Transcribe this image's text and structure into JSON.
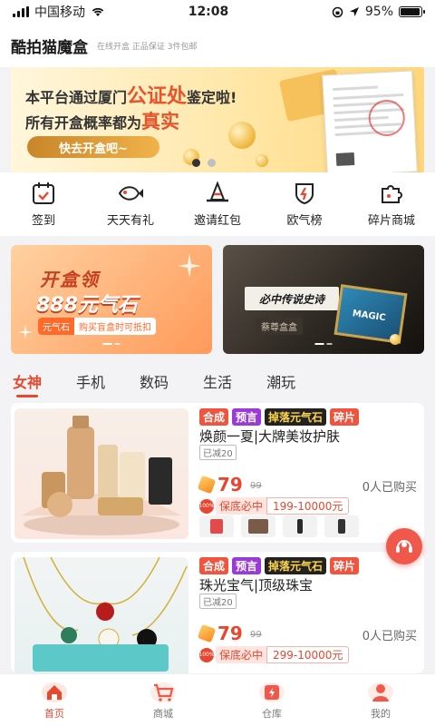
{
  "status_bar": {
    "carrier": "中国移动",
    "time": "12:08",
    "battery": "95%",
    "icons": [
      "signal-icon",
      "wifi-icon",
      "lock-rotation-icon",
      "location-icon",
      "battery-icon"
    ]
  },
  "header": {
    "title": "酷拍猫魔盒",
    "subtitle": "在线开盒 正品保证 3件包邮"
  },
  "banner": {
    "line1_prefix": "本平台通过厦门",
    "line1_highlight": "公证处",
    "line1_suffix": "鉴定啦!",
    "line2_prefix": "所有开盒概率都为",
    "line2_highlight": "真实",
    "button": "快去开盒吧~",
    "page_count": 2,
    "active_page": 1
  },
  "quick_nav": [
    {
      "label": "签到",
      "icon": "calendar-icon"
    },
    {
      "label": "天天有礼",
      "icon": "fish-gift-icon"
    },
    {
      "label": "邀请红包",
      "icon": "witch-hat-icon"
    },
    {
      "label": "欧气榜",
      "icon": "shield-rank-icon"
    },
    {
      "label": "碎片商城",
      "icon": "puzzle-icon"
    }
  ],
  "promo_left": {
    "title": "开盒领",
    "big": "888元气石",
    "tag_label": "元气石",
    "tag_text": "购买盲盒时可抵扣"
  },
  "promo_right": {
    "title": "必中传说史诗",
    "subtitle": "蔡尊盒盒",
    "crate_text": "MAGIC"
  },
  "categories": [
    {
      "label": "女神",
      "active": true
    },
    {
      "label": "手机",
      "active": false
    },
    {
      "label": "数码",
      "active": false
    },
    {
      "label": "生活",
      "active": false
    },
    {
      "label": "潮玩",
      "active": false
    }
  ],
  "products": [
    {
      "tags": [
        "合成",
        "预言",
        "掉落元气石",
        "碎片"
      ],
      "name": "焕颜一夏|大牌美妆护肤",
      "discount": "已减20",
      "price": "79",
      "old_price": "99",
      "sold": "0人已购买",
      "guarantee_badge": "100%",
      "guarantee_label": "保底必中",
      "guarantee_range": "199-10000元"
    },
    {
      "tags": [
        "合成",
        "预言",
        "掉落元气石",
        "碎片"
      ],
      "name": "珠光宝气|顶级珠宝",
      "discount": "已减20",
      "price": "79",
      "old_price": "99",
      "sold": "0人已购买",
      "guarantee_badge": "100%",
      "guarantee_label": "保底必中",
      "guarantee_range": "299-10000元"
    }
  ],
  "tabbar": [
    {
      "label": "首页",
      "icon": "home-icon",
      "active": true
    },
    {
      "label": "商城",
      "icon": "cart-icon",
      "active": false
    },
    {
      "label": "仓库",
      "icon": "warehouse-icon",
      "active": false
    },
    {
      "label": "我的",
      "icon": "profile-icon",
      "active": false
    }
  ],
  "colors": {
    "accent": "#e8472f",
    "purple_tag": "#9b3bd7",
    "gold": "#f1b24a"
  }
}
